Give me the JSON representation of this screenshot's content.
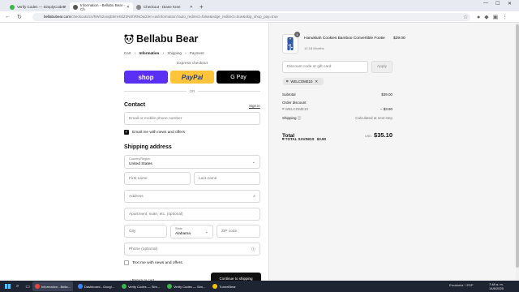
{
  "browser": {
    "tabs": [
      {
        "title": "Verify Codes — SimplyCodes",
        "color": "#3bb54a",
        "active": false
      },
      {
        "title": "Information - Bellabu Bear - Ch",
        "color": "#555555",
        "active": true
      },
      {
        "title": "Checkout - Diane Kree",
        "color": "#888888",
        "active": false
      }
    ],
    "new_tab": "+",
    "url_host": "bellabubear.com",
    "url_path": "/checkouts/cn/hWN2oxqE8mHSlZ2NrIhRNOw2/en-us/information?auto_redirect=false&edge_redirect=true&skip_shop_pay=true"
  },
  "checkout": {
    "brand": "Bellabu Bear",
    "breadcrumbs": {
      "cart": "Cart",
      "information": "Information",
      "shipping": "Shipping",
      "payment": "Payment",
      "sep": "›"
    },
    "express_label": "Express checkout",
    "shop_label": "shop",
    "paypal_label": "PayPal",
    "gpay_label": "G Pay",
    "or_label": "OR",
    "contact_heading": "Contact",
    "sign_in": "Sign in",
    "email_placeholder": "Email or mobile phone number",
    "email_news_label": "Email me with news and offers",
    "shipping_heading": "Shipping address",
    "country_label": "Country/Region",
    "country_value": "United States",
    "first_name": "First name",
    "last_name": "Last name",
    "address": "Address",
    "apartment": "Apartment, suite, etc. (optional)",
    "city": "City",
    "state_label": "State",
    "state_value": "Alabama",
    "zip": "ZIP code",
    "phone": "Phone (optional)",
    "text_news_label": "Text me with news and offers",
    "continue_button": "Continue to shipping",
    "return_link": "‹ Return to cart"
  },
  "summary": {
    "item_name": "Hanukkah Cookies Bamboo Convertible Footie",
    "item_variant": "12-18 Months",
    "item_qty": "1",
    "item_price": "$39.00",
    "discount_placeholder": "Discount code or gift card",
    "apply_button": "Apply",
    "applied_code": "WELCOME10",
    "subtotal_label": "Subtotal",
    "subtotal_value": "$39.00",
    "order_discount_label": "Order discount",
    "discount_code": "WELCOME10",
    "discount_value": "– $3.90",
    "shipping_label": "Shipping",
    "shipping_value": "Calculated at next step",
    "total_label": "Total",
    "total_currency": "USD",
    "total_value": "$35.10",
    "total_savings_label": "TOTAL SAVINGS",
    "total_savings_value": "$3.90"
  },
  "taskbar": {
    "tasks": [
      {
        "title": "Information - Bella...",
        "color": "#e8453c",
        "active": true
      },
      {
        "title": "Dashboard - Googl...",
        "color": "#4285f4",
        "active": false
      },
      {
        "title": "Verify Codes — Sim...",
        "color": "#3bb54a",
        "active": false
      },
      {
        "title": "Verify Codes — Sim...",
        "color": "#3bb54a",
        "active": false
      },
      {
        "title": "TunnelBear",
        "color": "#f5c400",
        "active": false
      }
    ],
    "tray_text": "Escalonia",
    "lang": "ESP",
    "time": "7:48 a. m.",
    "date": "14/8/2025"
  }
}
